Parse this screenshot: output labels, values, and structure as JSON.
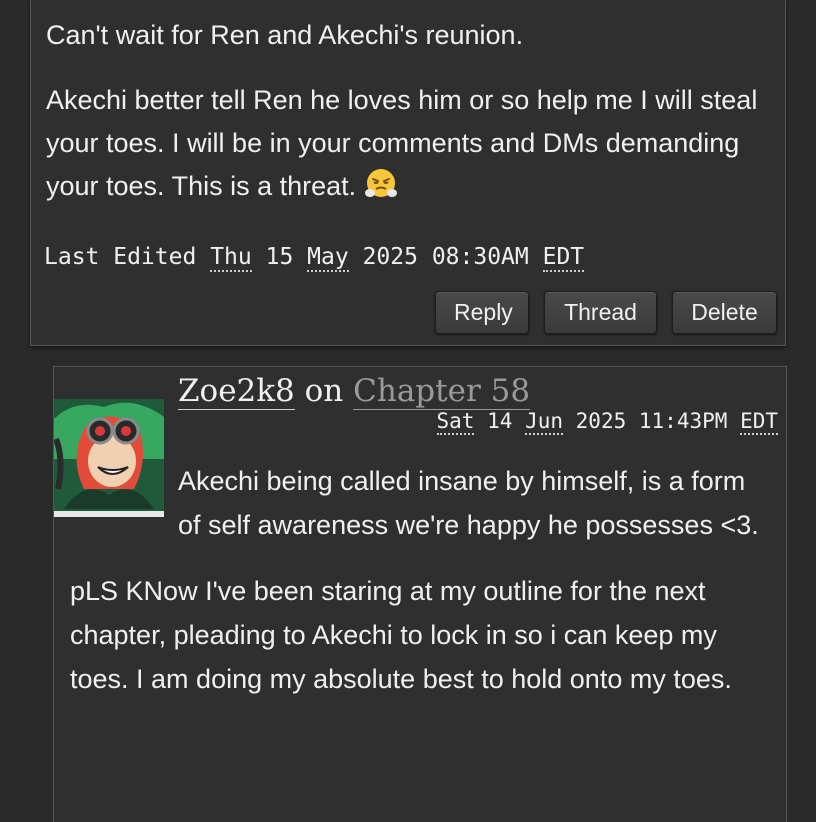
{
  "parent_comment": {
    "paragraphs": [
      "Can't wait for Ren and Akechi's reunion.",
      "Akechi better tell Ren he loves him or so help me I will steal your toes. I will be in your comments and DMs demanding your toes. This is a threat."
    ],
    "emoji_icon": "face-with-steam-from-nose-emoji",
    "last_edited_label": "Last Edited",
    "date": {
      "weekday": "Thu",
      "day": "15",
      "month": "May",
      "year": "2025",
      "time": "08:30AM",
      "tz": "EDT"
    },
    "buttons": {
      "reply": "Reply",
      "thread": "Thread",
      "delete": "Delete"
    }
  },
  "reply_comment": {
    "author": "Zoe2k8",
    "on_label": "on",
    "chapter": "Chapter 58",
    "date": {
      "weekday": "Sat",
      "day": "14",
      "month": "Jun",
      "year": "2025",
      "time": "11:43PM",
      "tz": "EDT"
    },
    "paragraphs": [
      "Akechi being called insane by himself, is a form of self awareness we're happy he possesses <3.",
      "pLS KNow I've been staring at my outline for the next chapter, pleading to Akechi to lock in so i can keep my toes. I am doing my absolute best to hold onto my toes."
    ]
  },
  "colors": {
    "background": "#2a2a2a",
    "card": "#2f2f2f",
    "border": "#555555",
    "text": "#f0f0f0",
    "muted_link": "#9a9a9a"
  }
}
